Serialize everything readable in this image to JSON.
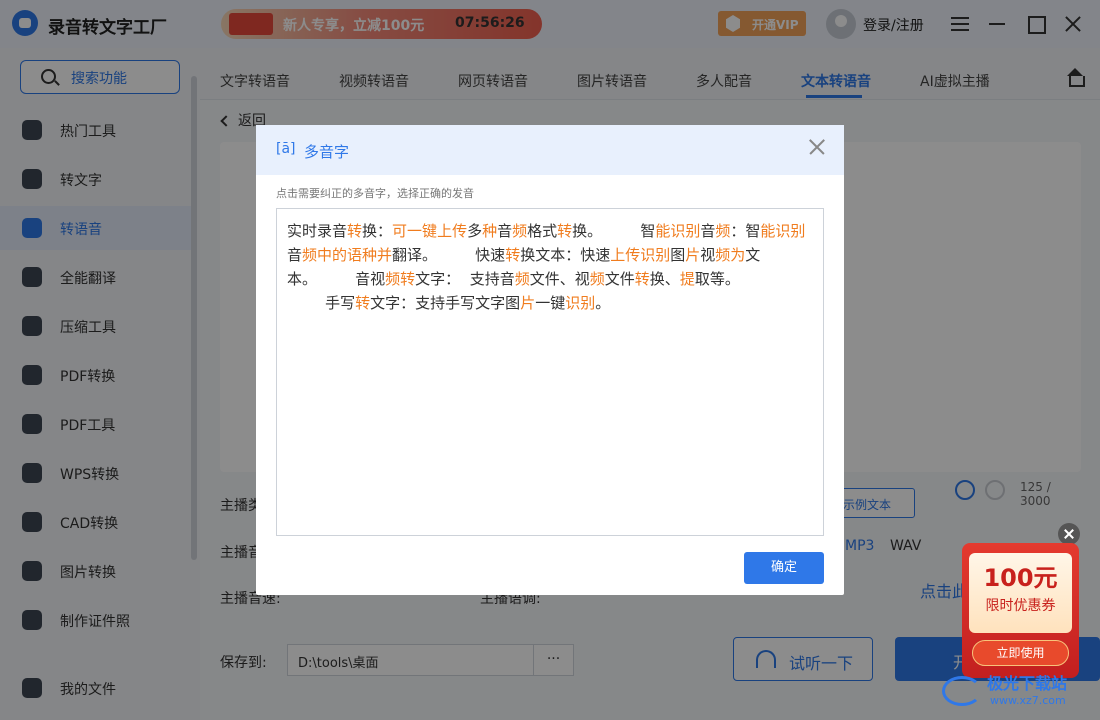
{
  "app": {
    "title": "录音转文字工厂",
    "promo_text": "新人专享，立减100元",
    "promo_timer": "07:56:26",
    "vip_label": "开通VIP",
    "login_label": "登录/注册"
  },
  "sidebar": {
    "search_label": "搜索功能",
    "items": [
      {
        "label": "热门工具",
        "icon": "fire-icon"
      },
      {
        "label": "转文字",
        "icon": "text-icon"
      },
      {
        "label": "转语音",
        "icon": "voice-icon"
      },
      {
        "label": "全能翻译",
        "icon": "translate-icon"
      },
      {
        "label": "压缩工具",
        "icon": "compress-icon"
      },
      {
        "label": "PDF转换",
        "icon": "pdf-icon"
      },
      {
        "label": "PDF工具",
        "icon": "toolbox-icon"
      },
      {
        "label": "WPS转换",
        "icon": "wps-icon"
      },
      {
        "label": "CAD转换",
        "icon": "cad-icon"
      },
      {
        "label": "图片转换",
        "icon": "image-icon"
      },
      {
        "label": "制作证件照",
        "icon": "id-photo-icon"
      },
      {
        "label": "我的文件",
        "icon": "file-icon"
      }
    ]
  },
  "tabs": [
    {
      "label": "文字转语音"
    },
    {
      "label": "视频转语音"
    },
    {
      "label": "网页转语音"
    },
    {
      "label": "图片转语音"
    },
    {
      "label": "多人配音"
    },
    {
      "label": "文本转语音"
    },
    {
      "label": "AI虚拟主播"
    }
  ],
  "main": {
    "back_label": "返回",
    "counter": "125 / 3000",
    "anchor_label": "主播类",
    "anchor_voice_label": "主播音",
    "speed_label": "主播音速:",
    "pitch_label": "主播语调:",
    "example_label": "示例文本",
    "format_mp3": "MP3",
    "format_wav": "WAV",
    "save_label": "保存到:",
    "save_path": "D:\\tools\\桌面",
    "path_more": "···",
    "listen_label": "试听一下",
    "start_partial": "开",
    "float_text": "点击此"
  },
  "modal": {
    "icon": "[ā]",
    "title": "多音字",
    "hint": "点击需要纠正的多音字，选择正确的发音",
    "segments": [
      [
        "实时录音",
        false
      ],
      [
        "转",
        true
      ],
      [
        "换：",
        false
      ],
      [
        "可一键",
        true
      ],
      [
        "上传",
        true
      ],
      [
        "多",
        false
      ],
      [
        "种",
        true
      ],
      [
        "音",
        false
      ],
      [
        "频",
        true
      ],
      [
        "格式",
        false
      ],
      [
        "转",
        true
      ],
      [
        "换。        智",
        false
      ],
      [
        "能识别",
        true
      ],
      [
        "音",
        false
      ],
      [
        "频",
        true
      ],
      [
        "：智",
        false
      ],
      [
        "能识别",
        true
      ],
      [
        "音",
        false
      ],
      [
        "频中的语种并",
        true
      ],
      [
        "翻译。        快速",
        false
      ],
      [
        "转",
        true
      ],
      [
        "换文本：快速",
        false
      ],
      [
        "上传识别",
        true
      ],
      [
        "图",
        false
      ],
      [
        "片",
        true
      ],
      [
        "视",
        false
      ],
      [
        "频为",
        true
      ],
      [
        "文本。        音视",
        false
      ],
      [
        "频转",
        true
      ],
      [
        "文字：  支持音",
        false
      ],
      [
        "频",
        true
      ],
      [
        "文件、视",
        false
      ],
      [
        "频",
        true
      ],
      [
        "文件",
        false
      ],
      [
        "转",
        true
      ],
      [
        "换、",
        false
      ],
      [
        "提",
        true
      ],
      [
        "取等。",
        false
      ],
      [
        "\n        手写",
        false
      ],
      [
        "转",
        true
      ],
      [
        "文字：支持手写文字图",
        false
      ],
      [
        "片",
        true
      ],
      [
        "一键",
        false
      ],
      [
        "识别",
        true
      ],
      [
        "。",
        false
      ]
    ],
    "ok_label": "确定"
  },
  "coupon": {
    "amount": "100元",
    "desc": "限时优惠券",
    "btn": "立即使用"
  },
  "watermark": {
    "text": "极光下载站",
    "url": "www.xz7.com"
  },
  "colors": {
    "accent": "#2f78e8",
    "highlight": "#f07c1e",
    "coupon_red": "#c8211c"
  }
}
